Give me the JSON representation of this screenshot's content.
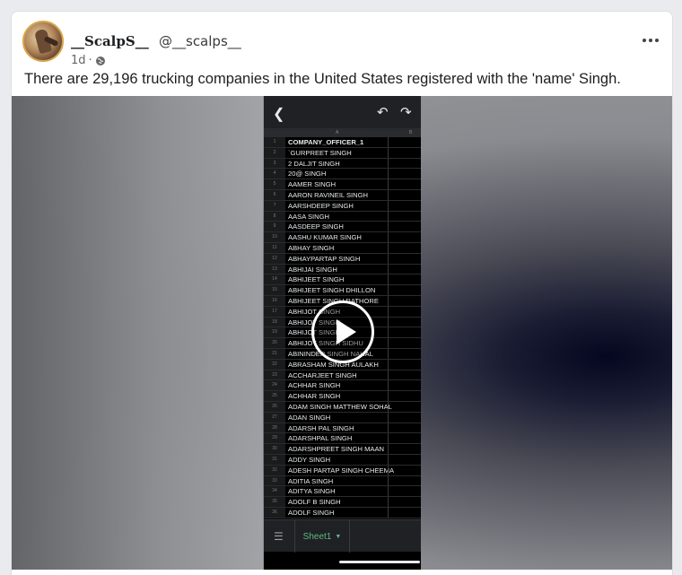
{
  "post": {
    "author_name": "__ScalpS__",
    "handle": "@__scalps__",
    "time": "1d",
    "separator": "·",
    "text": "There are 29,196 trucking companies in the United States registered with the 'name' Singh."
  },
  "spreadsheet": {
    "columns": [
      "A",
      "B"
    ],
    "rows": [
      {
        "n": "1",
        "v": "COMPANY_OFFICER_1"
      },
      {
        "n": "2",
        "v": "`GURPREET SINGH"
      },
      {
        "n": "3",
        "v": "2 DALJIT SINGH"
      },
      {
        "n": "4",
        "v": "20@ SINGH"
      },
      {
        "n": "5",
        "v": "AAMER SINGH"
      },
      {
        "n": "6",
        "v": "AARON RAVINEIL SINGH"
      },
      {
        "n": "7",
        "v": "AARSHDEEP SINGH"
      },
      {
        "n": "8",
        "v": "AASA SINGH"
      },
      {
        "n": "9",
        "v": "AASDEEP SINGH"
      },
      {
        "n": "10",
        "v": "AASHU KUMAR SINGH"
      },
      {
        "n": "11",
        "v": "ABHAY SINGH"
      },
      {
        "n": "12",
        "v": "ABHAYPARTAP SINGH"
      },
      {
        "n": "13",
        "v": "ABHIJAI SINGH"
      },
      {
        "n": "14",
        "v": "ABHIJEET SINGH"
      },
      {
        "n": "15",
        "v": "ABHIJEET SINGH DHILLON"
      },
      {
        "n": "16",
        "v": "ABHIJEET SINGH RATHORE"
      },
      {
        "n": "17",
        "v": "ABHIJOT SINGH"
      },
      {
        "n": "18",
        "v": "ABHIJOT SINGH"
      },
      {
        "n": "19",
        "v": "ABHIJOT SINGH"
      },
      {
        "n": "20",
        "v": "ABHIJOT SINGH SIDHU"
      },
      {
        "n": "21",
        "v": "ABININDER SINGH NAHAL"
      },
      {
        "n": "22",
        "v": "ABRASHAM SINGH AULAKH"
      },
      {
        "n": "23",
        "v": "ACCHARJEET SINGH"
      },
      {
        "n": "24",
        "v": "ACHHAR SINGH"
      },
      {
        "n": "25",
        "v": "ACHHAR SINGH"
      },
      {
        "n": "26",
        "v": "ADAM SINGH MATTHEW SOHAL"
      },
      {
        "n": "27",
        "v": "ADAN SINGH"
      },
      {
        "n": "28",
        "v": "ADARSH PAL SINGH"
      },
      {
        "n": "29",
        "v": "ADARSHPAL SINGH"
      },
      {
        "n": "30",
        "v": "ADARSHPREET SINGH MAAN"
      },
      {
        "n": "31",
        "v": "ADDY SINGH"
      },
      {
        "n": "32",
        "v": "ADESH PARTAP SINGH CHEEMA"
      },
      {
        "n": "33",
        "v": "ADITIA SINGH"
      },
      {
        "n": "34",
        "v": "ADITYA SINGH"
      },
      {
        "n": "35",
        "v": "ADOLF B SINGH"
      },
      {
        "n": "36",
        "v": "ADOLF SINGH"
      }
    ],
    "sheet_tab": "Sheet1"
  },
  "colors": {
    "sheet_tab_text": "#5cb985",
    "background": "#e9ebee"
  },
  "icons": {
    "privacy": "globe-icon",
    "more": "ellipsis-icon",
    "back": "arrow-left-icon",
    "undo": "undo-icon",
    "redo": "redo-icon",
    "play": "play-icon"
  }
}
